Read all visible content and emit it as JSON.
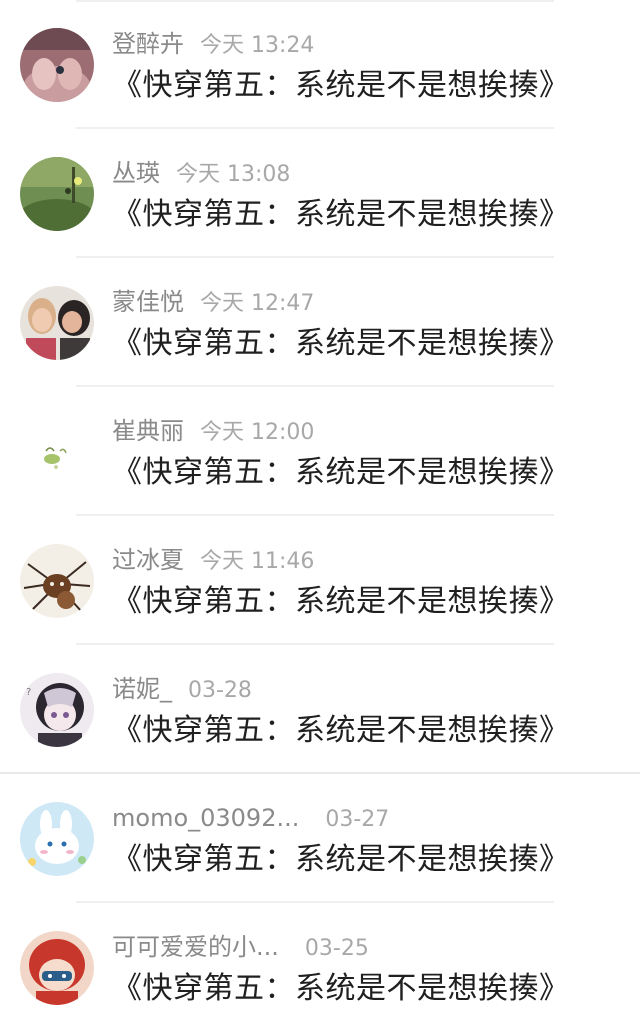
{
  "comments": [
    {
      "name": "登醉卉",
      "time": "今天 13:24",
      "text": "《快穿第五：系统是不是想挨揍》",
      "avatar": "hands-photo-avatar"
    },
    {
      "name": "丛瑛",
      "time": "今天 13:08",
      "text": "《快穿第五：系统是不是想挨揍》",
      "avatar": "grass-photo-avatar"
    },
    {
      "name": "蒙佳悦",
      "time": "今天 12:47",
      "text": "《快穿第五：系统是不是想挨揍》",
      "avatar": "girls-photo-avatar"
    },
    {
      "name": "崔典丽",
      "time": "今天 12:00",
      "text": "《快穿第五：系统是不是想挨揍》",
      "avatar": "sketch-avatar"
    },
    {
      "name": "过冰夏",
      "time": "今天 11:46",
      "text": "《快穿第五：系统是不是想挨揍》",
      "avatar": "spider-avatar"
    },
    {
      "name": "诺妮_",
      "time": "03-28",
      "text": "《快穿第五：系统是不是想挨揍》",
      "avatar": "anime-avatar"
    },
    {
      "name": "momo_03092...",
      "time": "03-27",
      "text": "《快穿第五：系统是不是想挨揍》",
      "avatar": "bunny-avatar"
    },
    {
      "name": "可可爱爱的小...",
      "time": "03-25",
      "text": "《快穿第五：系统是不是想挨揍》",
      "avatar": "redhead-avatar"
    }
  ]
}
